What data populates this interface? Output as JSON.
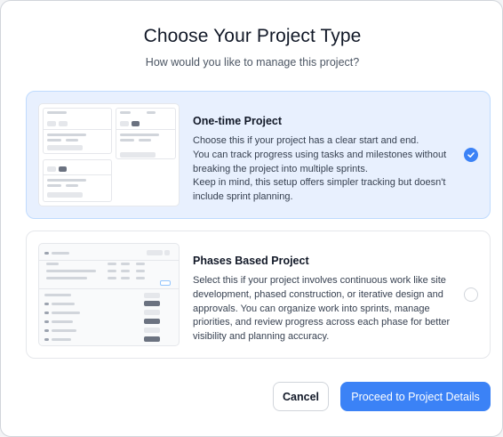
{
  "dialog": {
    "title": "Choose Your Project Type",
    "subtitle": "How would you like to manage this project?"
  },
  "options": [
    {
      "title": "One-time Project",
      "description_lines": [
        "Choose this if your project has a clear start and end.",
        "You can track progress using tasks and milestones without breaking the project into multiple sprints.",
        "Keep in mind, this setup offers simpler tracking but doesn't include sprint planning."
      ],
      "selected": true,
      "preview_icon": "single-project-preview"
    },
    {
      "title": "Phases Based Project",
      "description_lines": [
        "Select this if your project involves continuous work like site development, phased construction, or iterative design and approvals. You can organize work into sprints, manage priorities, and review progress across each phase for better visibility and planning accuracy."
      ],
      "selected": false,
      "preview_icon": "phases-project-preview"
    }
  ],
  "buttons": {
    "cancel": "Cancel",
    "proceed": "Proceed to Project Details"
  },
  "colors": {
    "accent": "#3b82f6",
    "selected_card_bg": "#e8f0fe"
  }
}
